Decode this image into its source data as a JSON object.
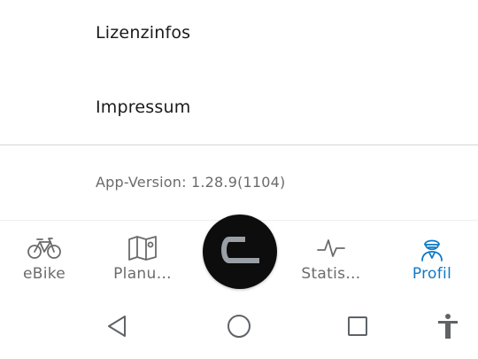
{
  "menu": {
    "items": [
      {
        "label": "Lizenzinfos"
      },
      {
        "label": "Impressum"
      }
    ],
    "version_text": "App-Version: 1.28.9(1104)"
  },
  "bottom_nav": {
    "tabs": [
      {
        "label": "eBike",
        "icon": "bike-icon",
        "active": false
      },
      {
        "label": "Planu…",
        "icon": "map-icon",
        "active": false
      },
      {
        "label": "Statis…",
        "icon": "pulse-icon",
        "active": false
      },
      {
        "label": "Profil",
        "icon": "profile-icon",
        "active": true
      }
    ],
    "center_icon": "ride-start-icon"
  },
  "system_nav": {
    "buttons": [
      "back-icon",
      "home-icon",
      "recents-icon",
      "accessibility-icon"
    ]
  },
  "colors": {
    "active": "#0f7ac5",
    "inactive": "#6b6b6b",
    "center_button": "#0d0d0d",
    "divider": "#d6d6d6"
  }
}
